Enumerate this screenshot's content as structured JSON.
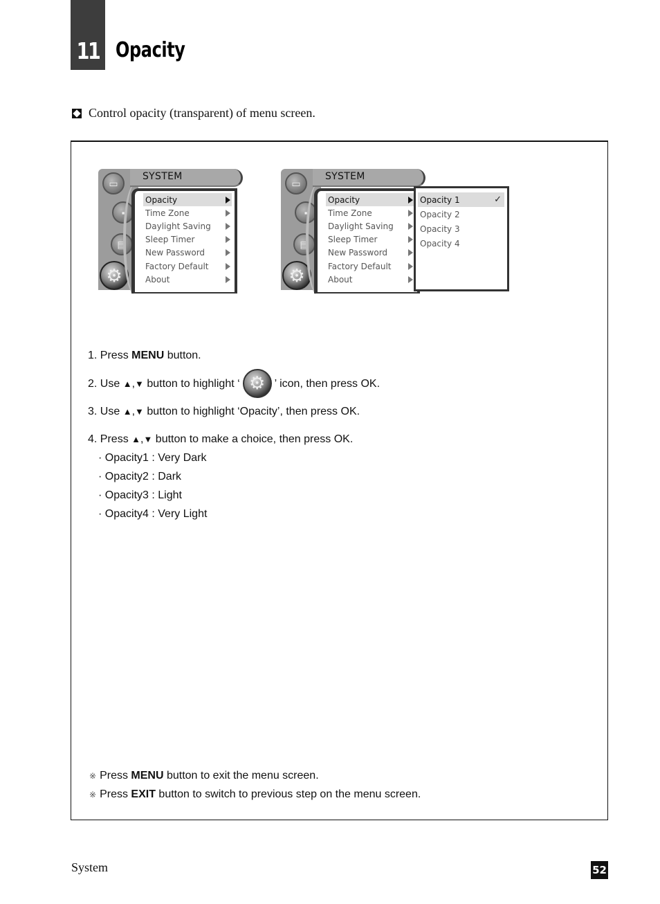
{
  "header": {
    "chapter_number": "11",
    "chapter_title": "Opacity"
  },
  "intro": {
    "icon": "diamond-in-square-icon",
    "text": "Control opacity (transparent)  of menu screen."
  },
  "osd_menus": [
    {
      "title": "SYSTEM",
      "sidebar_icons": [
        "tv-icon",
        "pc-audio-icon",
        "film-icon",
        "gear-icon"
      ],
      "items": [
        {
          "label": "Opacity",
          "selected": true
        },
        {
          "label": "Time Zone",
          "selected": false
        },
        {
          "label": "Daylight Saving",
          "selected": false
        },
        {
          "label": "Sleep Timer",
          "selected": false
        },
        {
          "label": "New Password",
          "selected": false
        },
        {
          "label": "Factory Default",
          "selected": false
        },
        {
          "label": "About",
          "selected": false
        }
      ]
    },
    {
      "title": "SYSTEM",
      "sidebar_icons": [
        "tv-icon",
        "pc-audio-icon",
        "film-icon",
        "gear-icon"
      ],
      "items": [
        {
          "label": "Opacity",
          "selected": true
        },
        {
          "label": "Time Zone",
          "selected": false
        },
        {
          "label": "Daylight Saving",
          "selected": false
        },
        {
          "label": "Sleep Timer",
          "selected": false
        },
        {
          "label": "New Password",
          "selected": false
        },
        {
          "label": "Factory Default",
          "selected": false
        },
        {
          "label": "About",
          "selected": false
        }
      ],
      "submenu": [
        {
          "label": "Opacity 1",
          "selected": true,
          "checked": true
        },
        {
          "label": "Opacity 2",
          "selected": false,
          "checked": false
        },
        {
          "label": "Opacity 3",
          "selected": false,
          "checked": false
        },
        {
          "label": "Opacity 4",
          "selected": false,
          "checked": false
        }
      ],
      "check_glyph": "✓"
    }
  ],
  "steps": {
    "s1": {
      "prefix": "1. Press ",
      "bold": "MENU",
      "suffix": " button."
    },
    "s2": {
      "prefix": "2. Use ",
      "up": "▲",
      "comma": ",",
      "down": "▼",
      "mid": " button to highlight ",
      "open_quote": "‘",
      "close_quote": "’",
      "suffix": " icon, then press OK."
    },
    "s3": {
      "prefix": "3. Use ",
      "up": "▲",
      "comma": ",",
      "down": "▼",
      "suffix": " button to highlight ‘Opacity’, then press OK."
    },
    "s4": {
      "prefix": "4. Press ",
      "up": "▲",
      "comma": ",",
      "down": "▼",
      "suffix": " button to make a choice, then press OK."
    },
    "options": [
      "· Opacity1 : Very Dark",
      "· Opacity2 : Dark",
      "· Opacity3 : Light",
      "· Opacity4 : Very Light"
    ]
  },
  "notes": [
    {
      "mark": "※",
      "prefix": "Press ",
      "bold": "MENU",
      "suffix": " button to exit the menu screen."
    },
    {
      "mark": "※",
      "prefix": "Press ",
      "bold": "EXIT",
      "suffix": " button to switch to previous step on the menu screen."
    }
  ],
  "footer": {
    "section": "System",
    "page_number": "52"
  }
}
